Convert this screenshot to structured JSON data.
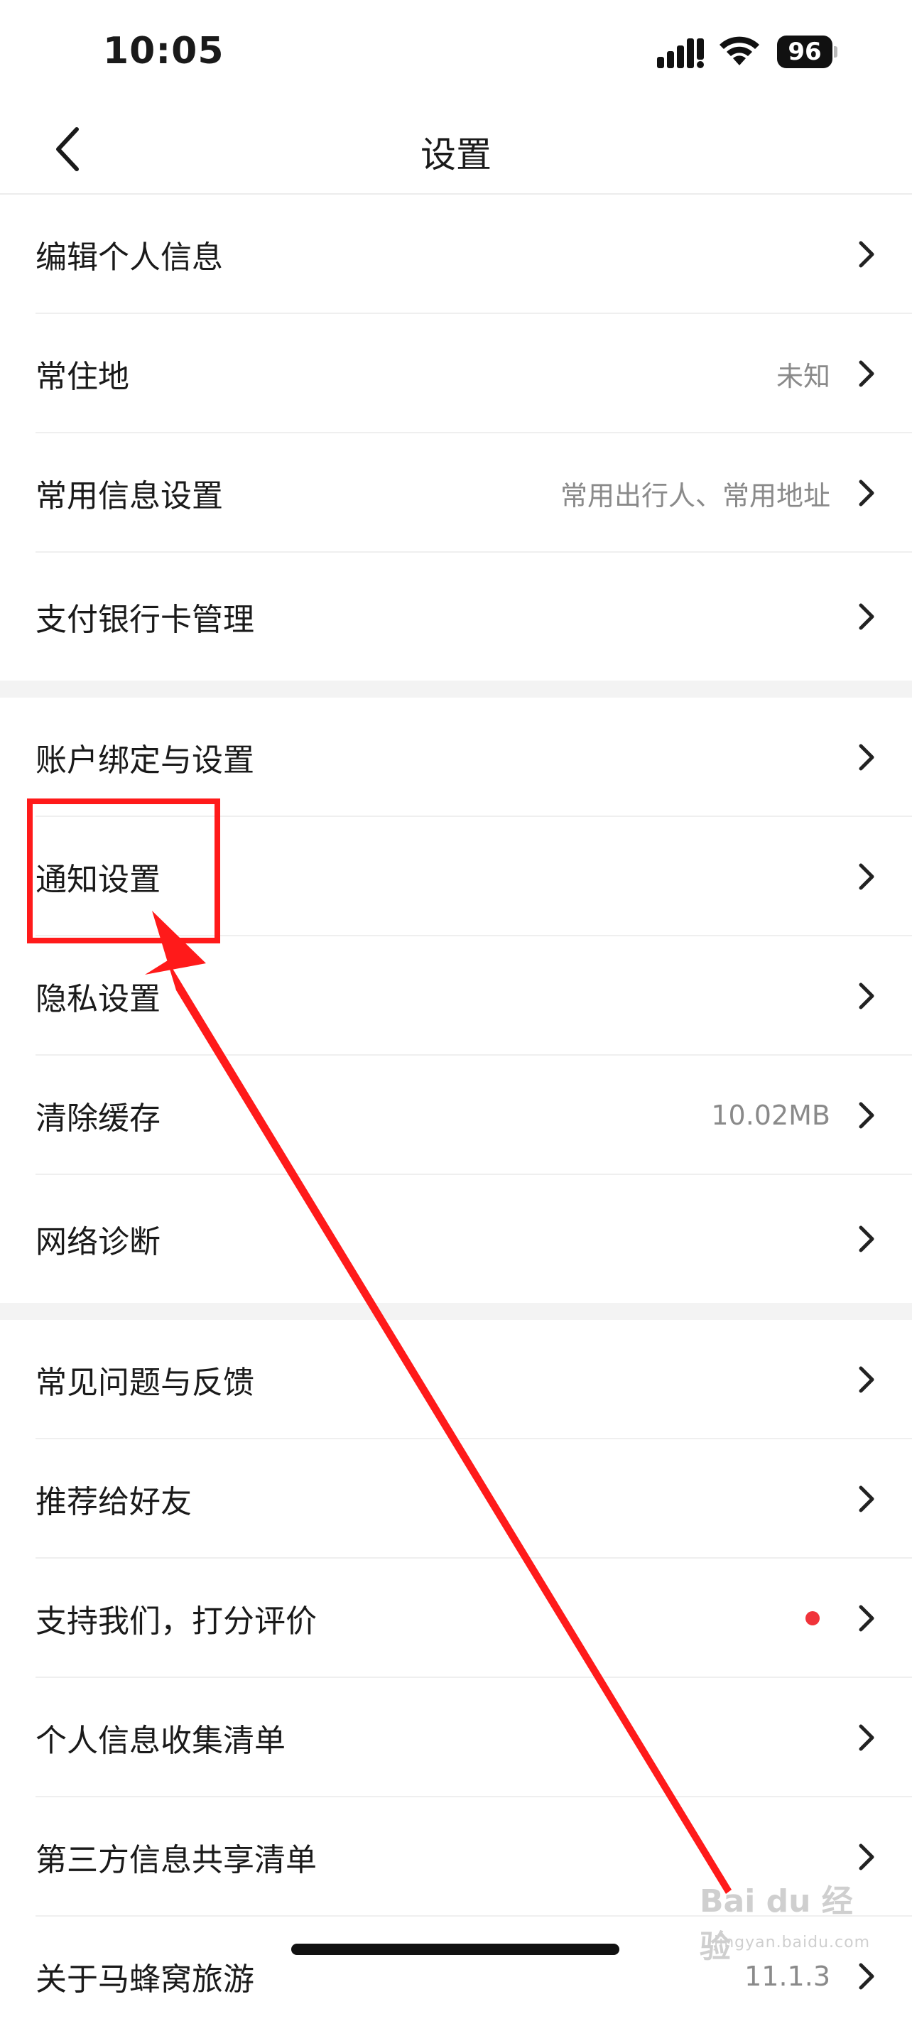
{
  "status_bar": {
    "time": "10:05",
    "battery": "96",
    "icons": [
      "signal-icon",
      "wifi-icon",
      "battery-icon"
    ]
  },
  "nav": {
    "title": "设置",
    "back_icon": "chevron-left-icon"
  },
  "sections": [
    {
      "items": [
        {
          "label": "编辑个人信息",
          "value": ""
        },
        {
          "label": "常住地",
          "value": "未知"
        },
        {
          "label": "常用信息设置",
          "value": "常用出行人、常用地址"
        },
        {
          "label": "支付银行卡管理",
          "value": ""
        }
      ]
    },
    {
      "items": [
        {
          "label": "账户绑定与设置",
          "value": ""
        },
        {
          "label": "通知设置",
          "value": ""
        },
        {
          "label": "隐私设置",
          "value": ""
        },
        {
          "label": "清除缓存",
          "value": "10.02MB"
        },
        {
          "label": "网络诊断",
          "value": ""
        }
      ]
    },
    {
      "items": [
        {
          "label": "常见问题与反馈",
          "value": ""
        },
        {
          "label": "推荐给好友",
          "value": ""
        },
        {
          "label": "支持我们，打分评价",
          "value": ""
        },
        {
          "label": "个人信息收集清单",
          "value": ""
        },
        {
          "label": "第三方信息共享清单",
          "value": ""
        },
        {
          "label": "关于马蜂窝旅游",
          "value": "11.1.3"
        }
      ]
    }
  ],
  "annotation": {
    "highlight_color": "#ff1a1a",
    "arrow_color": "#ff1a1a"
  },
  "watermark": {
    "text": "Bai du 经验",
    "sub": "jingyan.baidu.com"
  },
  "colors": {
    "accent_dot": "#f0333a",
    "secondary_text": "#8a8a8a"
  }
}
